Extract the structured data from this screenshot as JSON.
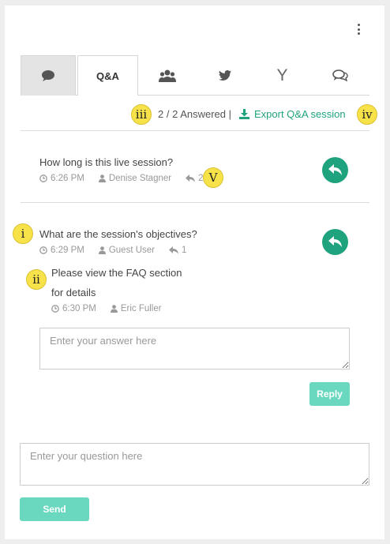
{
  "header": {
    "menu_icon": "more-vertical-icon"
  },
  "tabs": [
    {
      "icon": "chat-bubble-icon",
      "label": ""
    },
    {
      "icon": "",
      "label": "Q&A"
    },
    {
      "icon": "users-icon",
      "label": ""
    },
    {
      "icon": "twitter-icon",
      "label": ""
    },
    {
      "icon": "y-icon",
      "label": "Y"
    },
    {
      "icon": "comments-icon",
      "label": ""
    }
  ],
  "summary": {
    "answered": "2 / 2 Answered",
    "divider": "|",
    "export_label": "Export Q&A session"
  },
  "markers": {
    "i": "i",
    "ii": "ii",
    "iii": "iii",
    "iv": "iv",
    "v": "V"
  },
  "questions": [
    {
      "text": "How long is this live session?",
      "time": "6:26 PM",
      "author": "Denise Stagner",
      "reply_count": "2"
    },
    {
      "text": "What are the session's objectives?",
      "time": "6:29 PM",
      "author": "Guest User",
      "reply_count": "1",
      "answer": {
        "line1": "Please view the FAQ section",
        "line2": "for details",
        "time": "6:30 PM",
        "author": "Eric Fuller"
      }
    }
  ],
  "answer_form": {
    "placeholder": "Enter your answer here",
    "button": "Reply"
  },
  "question_form": {
    "placeholder": "Enter your question here",
    "button": "Send"
  },
  "colors": {
    "accent": "#1fa37f",
    "button": "#6ad8bf",
    "marker": "#f7e24a"
  }
}
